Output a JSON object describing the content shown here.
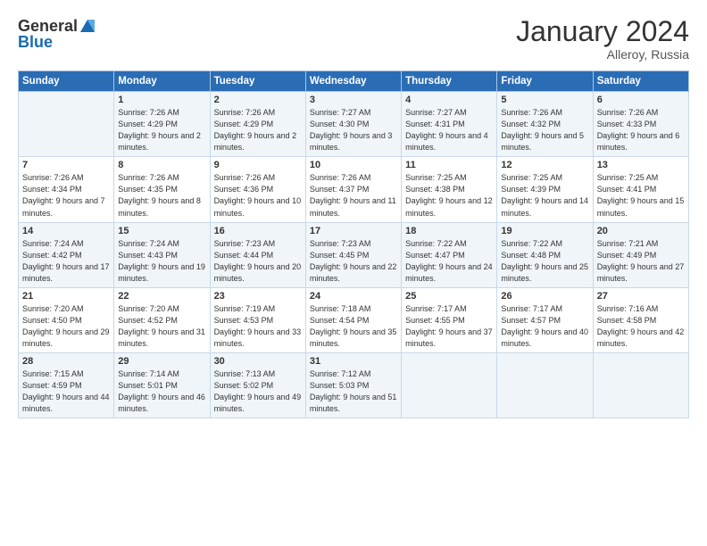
{
  "header": {
    "logo_general": "General",
    "logo_blue": "Blue",
    "month_year": "January 2024",
    "location": "Alleroy, Russia"
  },
  "columns": [
    "Sunday",
    "Monday",
    "Tuesday",
    "Wednesday",
    "Thursday",
    "Friday",
    "Saturday"
  ],
  "weeks": [
    [
      {
        "day": "",
        "sunrise": "",
        "sunset": "",
        "daylight": ""
      },
      {
        "day": "1",
        "sunrise": "Sunrise: 7:26 AM",
        "sunset": "Sunset: 4:29 PM",
        "daylight": "Daylight: 9 hours and 2 minutes."
      },
      {
        "day": "2",
        "sunrise": "Sunrise: 7:26 AM",
        "sunset": "Sunset: 4:29 PM",
        "daylight": "Daylight: 9 hours and 2 minutes."
      },
      {
        "day": "3",
        "sunrise": "Sunrise: 7:27 AM",
        "sunset": "Sunset: 4:30 PM",
        "daylight": "Daylight: 9 hours and 3 minutes."
      },
      {
        "day": "4",
        "sunrise": "Sunrise: 7:27 AM",
        "sunset": "Sunset: 4:31 PM",
        "daylight": "Daylight: 9 hours and 4 minutes."
      },
      {
        "day": "5",
        "sunrise": "Sunrise: 7:26 AM",
        "sunset": "Sunset: 4:32 PM",
        "daylight": "Daylight: 9 hours and 5 minutes."
      },
      {
        "day": "6",
        "sunrise": "Sunrise: 7:26 AM",
        "sunset": "Sunset: 4:33 PM",
        "daylight": "Daylight: 9 hours and 6 minutes."
      }
    ],
    [
      {
        "day": "7",
        "sunrise": "Sunrise: 7:26 AM",
        "sunset": "Sunset: 4:34 PM",
        "daylight": "Daylight: 9 hours and 7 minutes."
      },
      {
        "day": "8",
        "sunrise": "Sunrise: 7:26 AM",
        "sunset": "Sunset: 4:35 PM",
        "daylight": "Daylight: 9 hours and 8 minutes."
      },
      {
        "day": "9",
        "sunrise": "Sunrise: 7:26 AM",
        "sunset": "Sunset: 4:36 PM",
        "daylight": "Daylight: 9 hours and 10 minutes."
      },
      {
        "day": "10",
        "sunrise": "Sunrise: 7:26 AM",
        "sunset": "Sunset: 4:37 PM",
        "daylight": "Daylight: 9 hours and 11 minutes."
      },
      {
        "day": "11",
        "sunrise": "Sunrise: 7:25 AM",
        "sunset": "Sunset: 4:38 PM",
        "daylight": "Daylight: 9 hours and 12 minutes."
      },
      {
        "day": "12",
        "sunrise": "Sunrise: 7:25 AM",
        "sunset": "Sunset: 4:39 PM",
        "daylight": "Daylight: 9 hours and 14 minutes."
      },
      {
        "day": "13",
        "sunrise": "Sunrise: 7:25 AM",
        "sunset": "Sunset: 4:41 PM",
        "daylight": "Daylight: 9 hours and 15 minutes."
      }
    ],
    [
      {
        "day": "14",
        "sunrise": "Sunrise: 7:24 AM",
        "sunset": "Sunset: 4:42 PM",
        "daylight": "Daylight: 9 hours and 17 minutes."
      },
      {
        "day": "15",
        "sunrise": "Sunrise: 7:24 AM",
        "sunset": "Sunset: 4:43 PM",
        "daylight": "Daylight: 9 hours and 19 minutes."
      },
      {
        "day": "16",
        "sunrise": "Sunrise: 7:23 AM",
        "sunset": "Sunset: 4:44 PM",
        "daylight": "Daylight: 9 hours and 20 minutes."
      },
      {
        "day": "17",
        "sunrise": "Sunrise: 7:23 AM",
        "sunset": "Sunset: 4:45 PM",
        "daylight": "Daylight: 9 hours and 22 minutes."
      },
      {
        "day": "18",
        "sunrise": "Sunrise: 7:22 AM",
        "sunset": "Sunset: 4:47 PM",
        "daylight": "Daylight: 9 hours and 24 minutes."
      },
      {
        "day": "19",
        "sunrise": "Sunrise: 7:22 AM",
        "sunset": "Sunset: 4:48 PM",
        "daylight": "Daylight: 9 hours and 25 minutes."
      },
      {
        "day": "20",
        "sunrise": "Sunrise: 7:21 AM",
        "sunset": "Sunset: 4:49 PM",
        "daylight": "Daylight: 9 hours and 27 minutes."
      }
    ],
    [
      {
        "day": "21",
        "sunrise": "Sunrise: 7:20 AM",
        "sunset": "Sunset: 4:50 PM",
        "daylight": "Daylight: 9 hours and 29 minutes."
      },
      {
        "day": "22",
        "sunrise": "Sunrise: 7:20 AM",
        "sunset": "Sunset: 4:52 PM",
        "daylight": "Daylight: 9 hours and 31 minutes."
      },
      {
        "day": "23",
        "sunrise": "Sunrise: 7:19 AM",
        "sunset": "Sunset: 4:53 PM",
        "daylight": "Daylight: 9 hours and 33 minutes."
      },
      {
        "day": "24",
        "sunrise": "Sunrise: 7:18 AM",
        "sunset": "Sunset: 4:54 PM",
        "daylight": "Daylight: 9 hours and 35 minutes."
      },
      {
        "day": "25",
        "sunrise": "Sunrise: 7:17 AM",
        "sunset": "Sunset: 4:55 PM",
        "daylight": "Daylight: 9 hours and 37 minutes."
      },
      {
        "day": "26",
        "sunrise": "Sunrise: 7:17 AM",
        "sunset": "Sunset: 4:57 PM",
        "daylight": "Daylight: 9 hours and 40 minutes."
      },
      {
        "day": "27",
        "sunrise": "Sunrise: 7:16 AM",
        "sunset": "Sunset: 4:58 PM",
        "daylight": "Daylight: 9 hours and 42 minutes."
      }
    ],
    [
      {
        "day": "28",
        "sunrise": "Sunrise: 7:15 AM",
        "sunset": "Sunset: 4:59 PM",
        "daylight": "Daylight: 9 hours and 44 minutes."
      },
      {
        "day": "29",
        "sunrise": "Sunrise: 7:14 AM",
        "sunset": "Sunset: 5:01 PM",
        "daylight": "Daylight: 9 hours and 46 minutes."
      },
      {
        "day": "30",
        "sunrise": "Sunrise: 7:13 AM",
        "sunset": "Sunset: 5:02 PM",
        "daylight": "Daylight: 9 hours and 49 minutes."
      },
      {
        "day": "31",
        "sunrise": "Sunrise: 7:12 AM",
        "sunset": "Sunset: 5:03 PM",
        "daylight": "Daylight: 9 hours and 51 minutes."
      },
      {
        "day": "",
        "sunrise": "",
        "sunset": "",
        "daylight": ""
      },
      {
        "day": "",
        "sunrise": "",
        "sunset": "",
        "daylight": ""
      },
      {
        "day": "",
        "sunrise": "",
        "sunset": "",
        "daylight": ""
      }
    ]
  ]
}
